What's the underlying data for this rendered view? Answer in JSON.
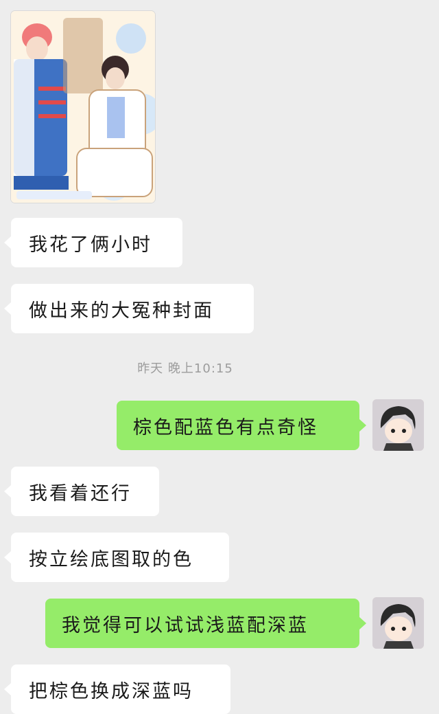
{
  "chat": {
    "image_message": {
      "icon": "poster-image"
    },
    "messages": [
      {
        "side": "in",
        "text": "我花了俩小时"
      },
      {
        "side": "in",
        "text": "做出来的大冤种封面"
      },
      {
        "side": "out",
        "text": "棕色配蓝色有点奇怪"
      },
      {
        "side": "in",
        "text": "我看着还行"
      },
      {
        "side": "in",
        "text": "按立绘底图取的色"
      },
      {
        "side": "out",
        "text": "我觉得可以试试浅蓝配深蓝"
      },
      {
        "side": "in",
        "text": "把棕色换成深蓝吗"
      }
    ],
    "timestamp": "昨天 晚上10:15"
  },
  "colors": {
    "background": "#ededed",
    "incoming_bubble": "#ffffff",
    "outgoing_bubble": "#95ec69",
    "timestamp_text": "#9c9c9c"
  }
}
